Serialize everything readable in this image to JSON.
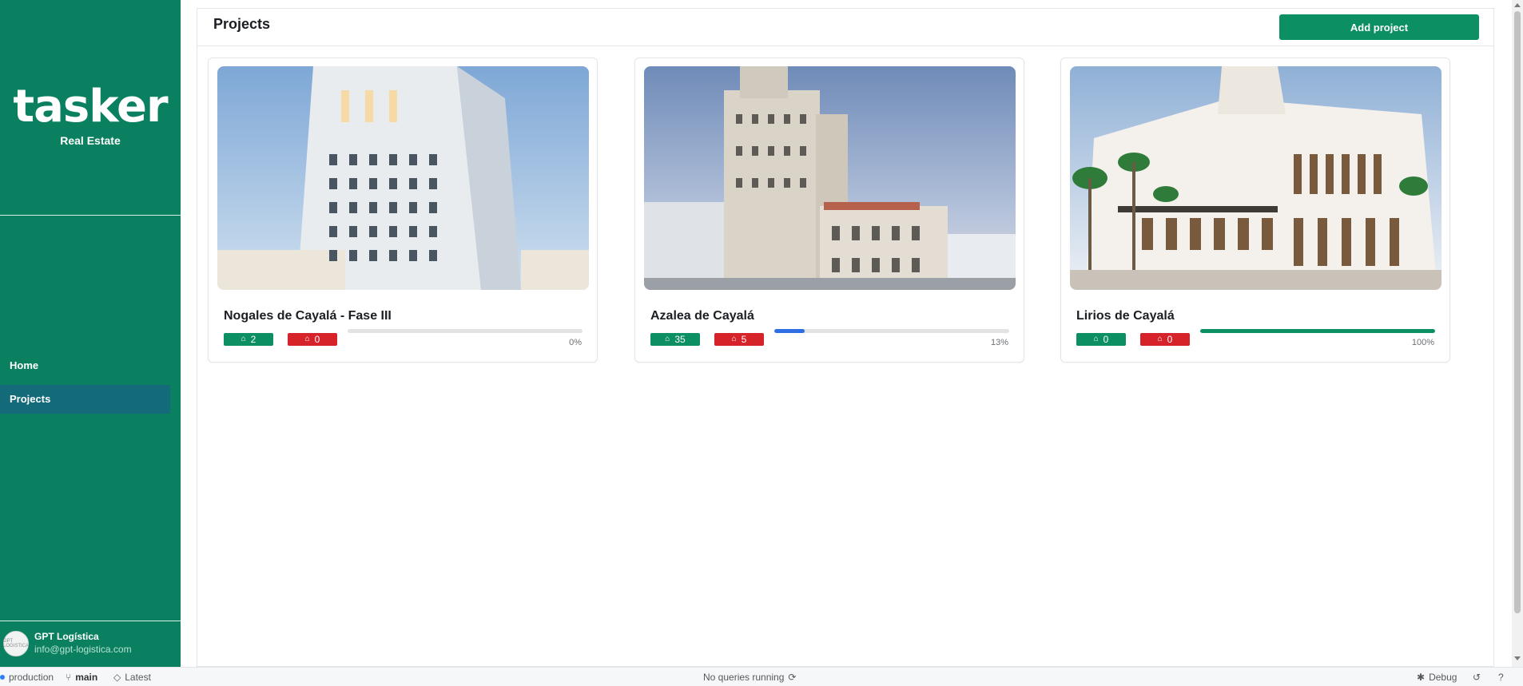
{
  "sidebar": {
    "logo": "tasker",
    "subtitle": "Real Estate",
    "nav": [
      {
        "label": "Home",
        "active": false
      },
      {
        "label": "Projects",
        "active": true
      }
    ],
    "user": {
      "name": "GPT Logística",
      "email": "info@gpt-logistica.com",
      "avatar_text": "GPT LOGISTICA"
    }
  },
  "header": {
    "title": "Projects",
    "add_button": "Add project"
  },
  "projects": [
    {
      "title": "Nogales de Cayalá - Fase III",
      "ok_count": "2",
      "issue_count": "0",
      "progress": 0,
      "progress_label": "0%",
      "progress_color": "#e1e3e5"
    },
    {
      "title": "Azalea de Cayalá",
      "ok_count": "35",
      "issue_count": "5",
      "progress": 0.13,
      "progress_label": "13%",
      "progress_color": "#2f6de5"
    },
    {
      "title": "Lirios de Cayalá",
      "ok_count": "0",
      "issue_count": "0",
      "progress": 1.0,
      "progress_label": "100%",
      "progress_color": "#0b8f63"
    }
  ],
  "icons": {
    "badge": "home-outline-icon"
  },
  "statusbar": {
    "env": "production",
    "branch": "main",
    "tag": "Latest",
    "queries": "No queries running",
    "debug": "Debug"
  },
  "colors": {
    "sidebar_bg": "#0b8060",
    "active_nav": "#136b7a",
    "primary": "#0b8f63",
    "danger": "#d6232a"
  }
}
